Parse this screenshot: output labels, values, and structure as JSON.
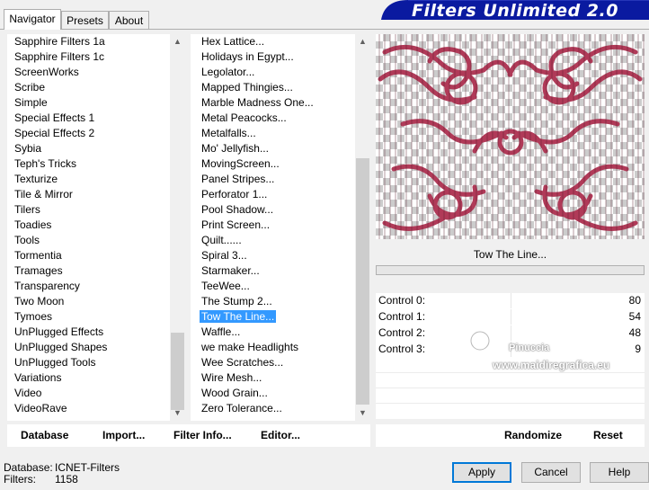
{
  "tabs": [
    "Navigator",
    "Presets",
    "About"
  ],
  "banner": {
    "title": "Filters Unlimited 2.0"
  },
  "categories": {
    "items": [
      "Sapphire Filters 1a",
      "Sapphire Filters 1c",
      "ScreenWorks",
      "Scribe",
      "Simple",
      "Special Effects 1",
      "Special Effects 2",
      "Sybia",
      "Teph's Tricks",
      "Texturize",
      "Tile & Mirror",
      "Tilers",
      "Toadies",
      "Tools",
      "Tormentia",
      "Tramages",
      "Transparency",
      "Two Moon",
      "Tymoes",
      "UnPlugged Effects",
      "UnPlugged Shapes",
      "UnPlugged Tools",
      "Variations",
      "Video",
      "VideoRave"
    ],
    "scroll_position": 0.85
  },
  "filters": {
    "items": [
      "Hex Lattice...",
      "Holidays in Egypt...",
      "Legolator...",
      "Mapped Thingies...",
      "Marble Madness One...",
      "Metal Peacocks...",
      "Metalfalls...",
      "Mo' Jellyfish...",
      "MovingScreen...",
      "Panel Stripes...",
      "Perforator 1...",
      "Pool Shadow...",
      "Print Screen...",
      "Quilt......",
      "Spiral 3...",
      "Starmaker...",
      "TeeWee...",
      "The Stump 2...",
      "Tow The Line...",
      "Waffle...",
      "we make Headlights",
      "Wee Scratches...",
      "Wire Mesh...",
      "Wood Grain...",
      "Zero Tolerance..."
    ],
    "selected": "Tow The Line...",
    "scroll_position": 0.7
  },
  "preview": {
    "filter_name": "Tow The Line...",
    "accent": "#b03a58",
    "progress": 0
  },
  "controls": [
    {
      "label": "Control 0:",
      "value": "80"
    },
    {
      "label": "Control 1:",
      "value": "54"
    },
    {
      "label": "Control 2:",
      "value": "48"
    },
    {
      "label": "Control 3:",
      "value": "9"
    }
  ],
  "watermark": {
    "line1": "Pinuccia",
    "line2": "www.maidiregrafica.eu"
  },
  "left_bar": {
    "database": "Database",
    "import": "Import...",
    "filter_info": "Filter Info...",
    "editor": "Editor..."
  },
  "right_bar": {
    "randomize": "Randomize",
    "reset": "Reset"
  },
  "status": {
    "database_label": "Database:",
    "database_value": "ICNET-Filters",
    "filters_label": "Filters:",
    "filters_value": "1158"
  },
  "buttons": {
    "apply": "Apply",
    "cancel": "Cancel",
    "help": "Help"
  },
  "colors": {
    "banner_bg": "#0a1aa0",
    "selection": "#3399ff",
    "default_button_border": "#0078d7"
  }
}
